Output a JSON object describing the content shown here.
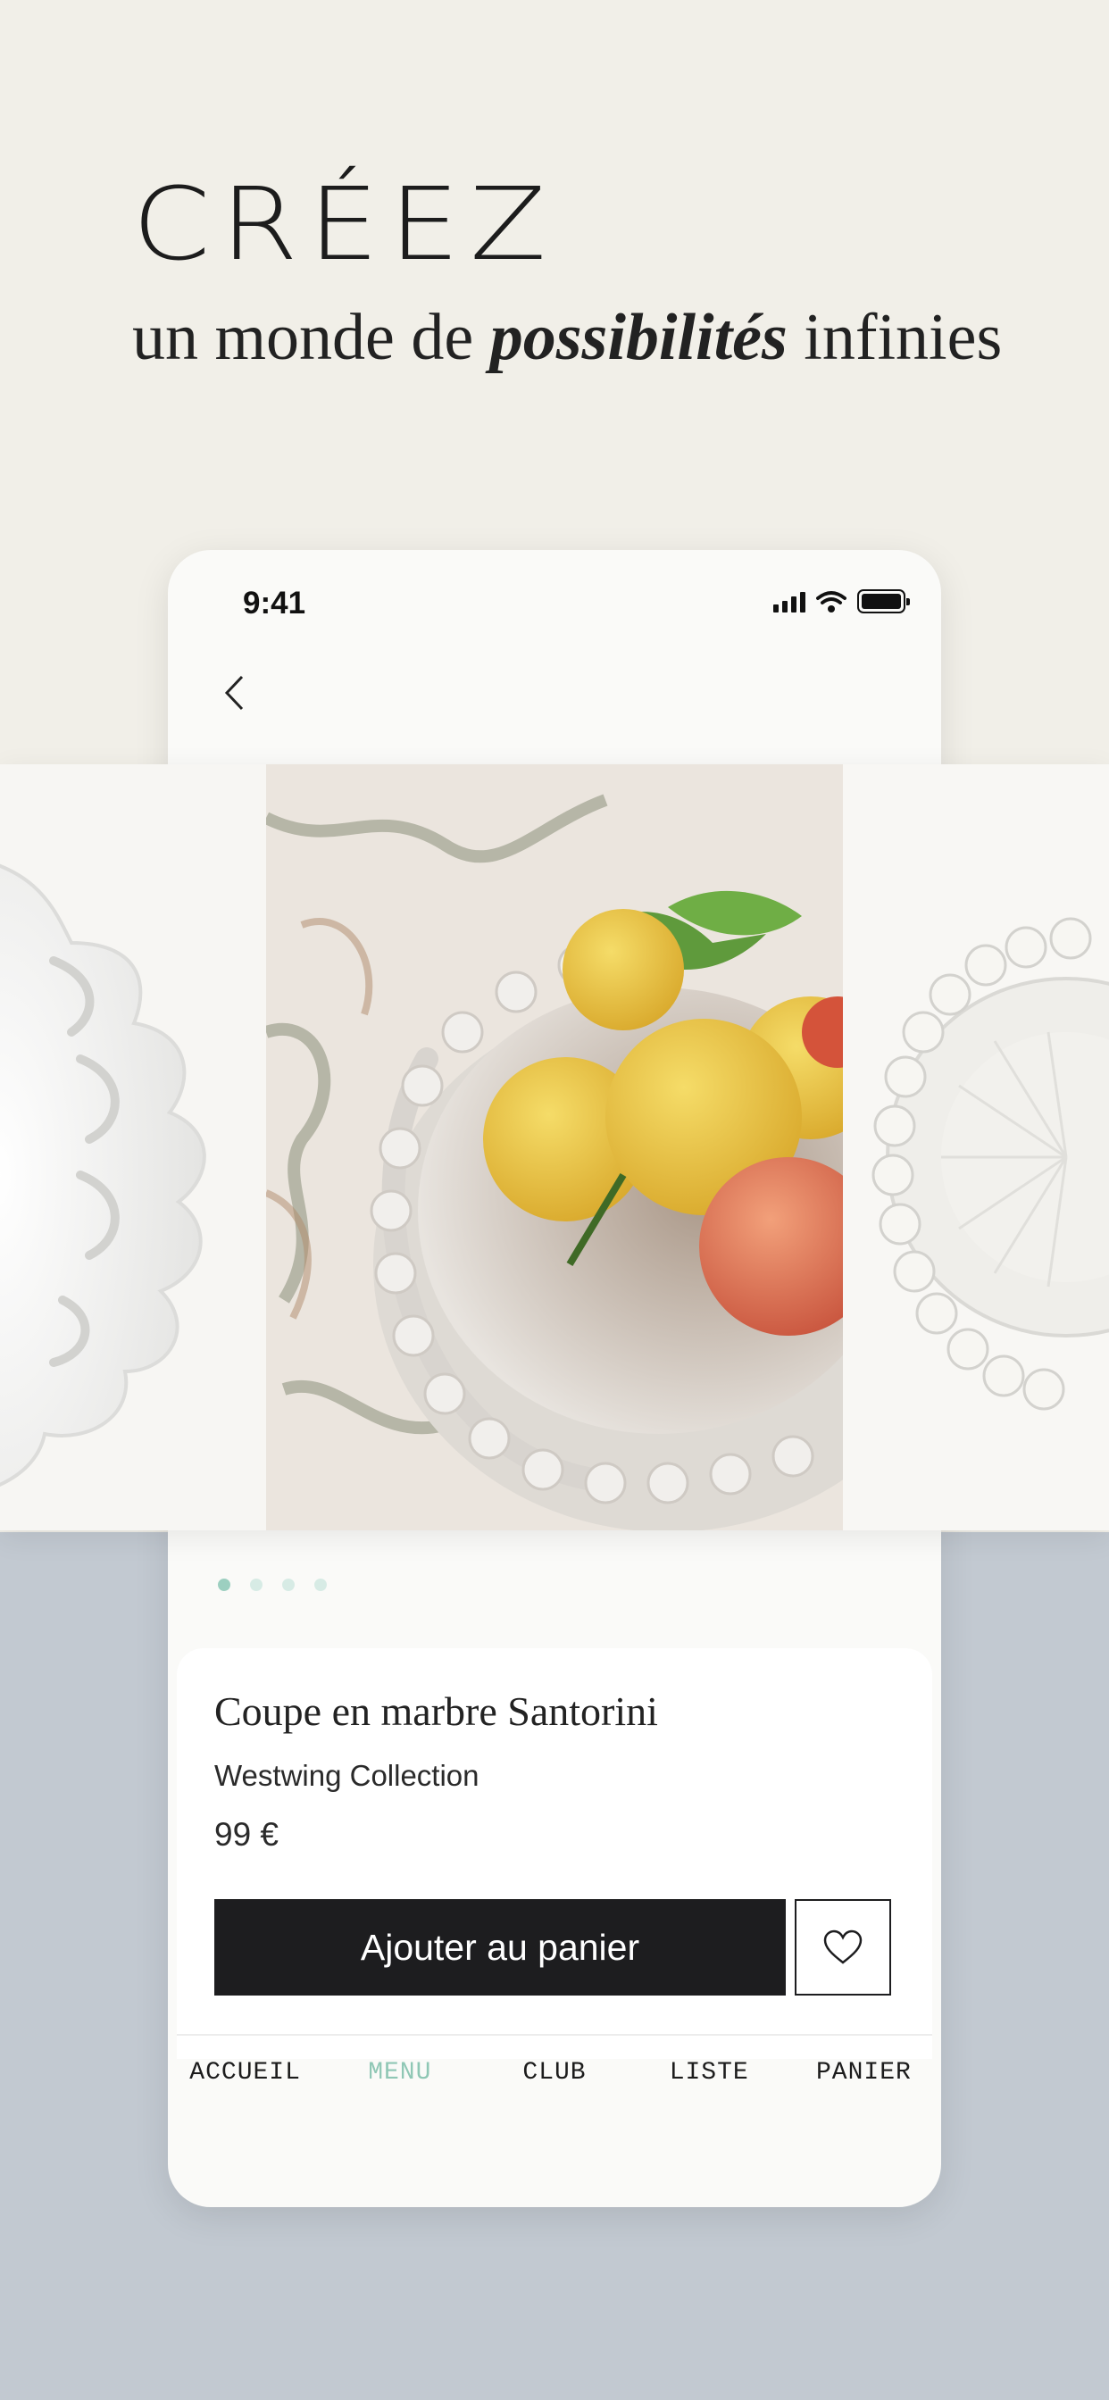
{
  "hero": {
    "headline": "CRÉEZ",
    "sub_before": "un monde de",
    "sub_emphasis": "possibilités",
    "sub_after": "infinies"
  },
  "status_bar": {
    "time": "9:41"
  },
  "carousel": {
    "slide_count": 4,
    "active_index": 0
  },
  "product": {
    "name": "Coupe en marbre Santorini",
    "brand": "Westwing Collection",
    "price": "99 €",
    "add_to_cart_label": "Ajouter au panier"
  },
  "tabbar": {
    "items": [
      {
        "label": "ACCUEIL",
        "active": false
      },
      {
        "label": "MENU",
        "active": true
      },
      {
        "label": "CLUB",
        "active": false
      },
      {
        "label": "LISTE",
        "active": false
      },
      {
        "label": "PANIER",
        "active": false
      }
    ]
  },
  "colors": {
    "top_background": "#f1efe8",
    "bottom_background": "#c2c9d1",
    "accent": "#8fc7b5",
    "button_dark": "#1d1d1f"
  }
}
